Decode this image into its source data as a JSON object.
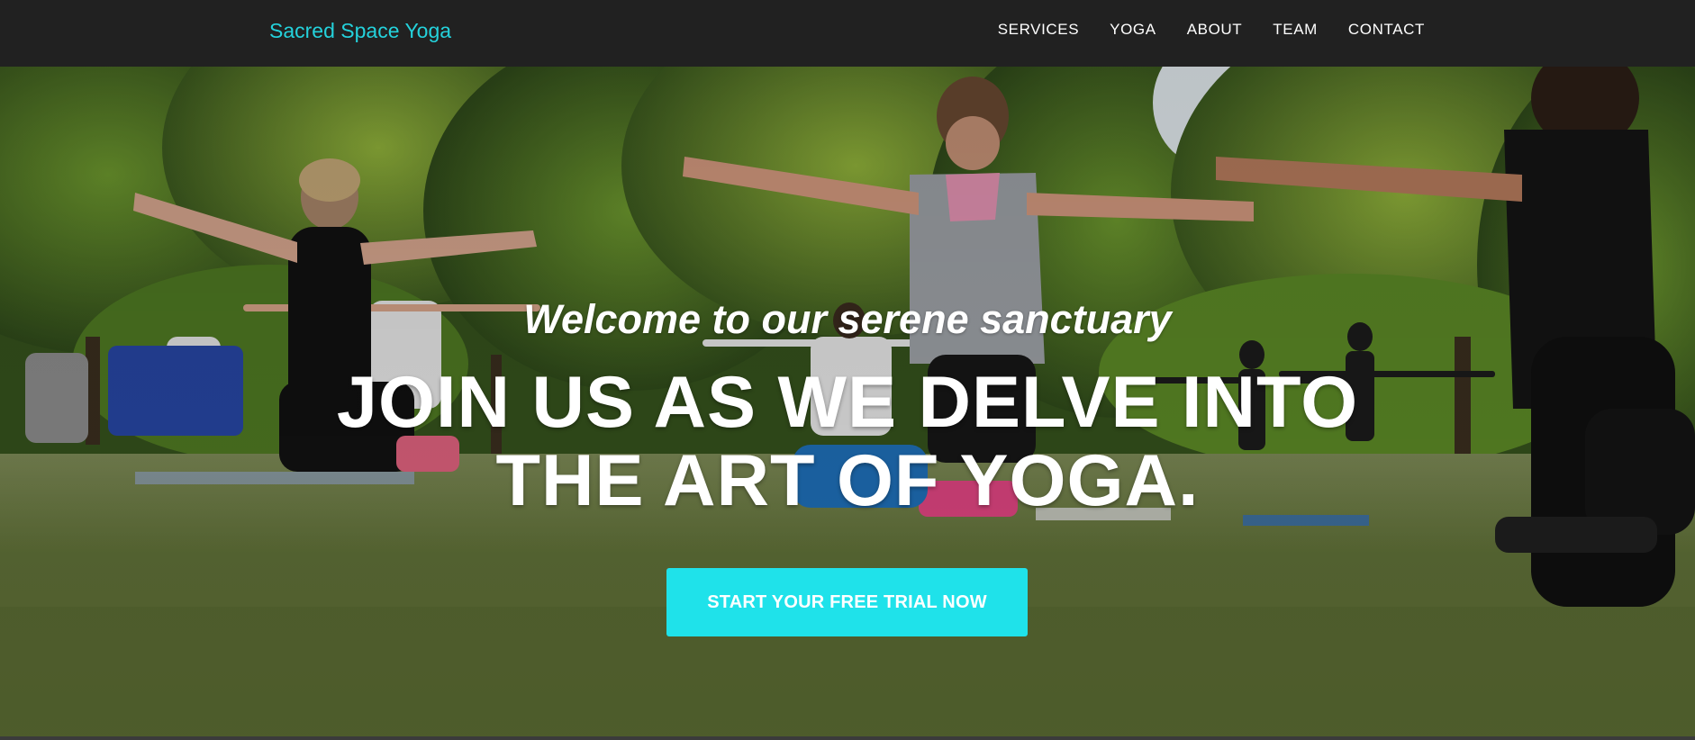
{
  "brand": "Sacred Space Yoga",
  "nav": {
    "items": [
      "SERVICES",
      "YOGA",
      "ABOUT",
      "TEAM",
      "CONTACT"
    ]
  },
  "hero": {
    "subtitle": "Welcome to our serene sanctuary",
    "headline_line1": "JOIN US AS WE DELVE INTO",
    "headline_line2": "THE ART OF YOGA.",
    "cta_label": "START YOUR FREE TRIAL NOW",
    "background": "outdoor yoga class on grass in a park"
  },
  "colors": {
    "nav_bg": "#212121",
    "brand": "#24d2dc",
    "cta_bg": "#1fe2ea",
    "text": "#ffffff"
  }
}
